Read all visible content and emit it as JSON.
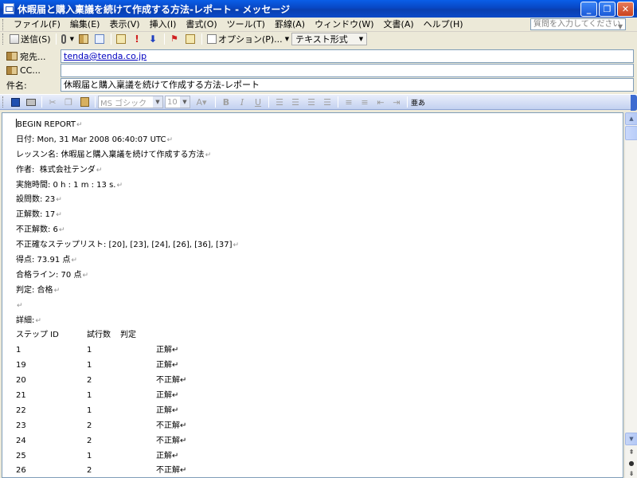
{
  "window": {
    "title": "休暇届と購入稟議を続けて作成する方法-レポート - メッセージ",
    "minimize": "_",
    "maximize": "❐",
    "close": "✕"
  },
  "menu": {
    "items": [
      "ファイル(F)",
      "編集(E)",
      "表示(V)",
      "挿入(I)",
      "書式(O)",
      "ツール(T)",
      "罫線(A)",
      "ウィンドウ(W)",
      "文書(A)",
      "ヘルプ(H)"
    ],
    "help_placeholder": "質問を入力してください"
  },
  "toolbar": {
    "send_label": "送信(S)",
    "options_label": "オプション(P)...",
    "format_value": "テキスト形式"
  },
  "fields": {
    "to_label": "宛先...",
    "to_value": "tenda@tenda.co.jp",
    "cc_label": "CC...",
    "cc_value": "",
    "subject_label": "件名:",
    "subject_value": "休暇届と購入稟議を続けて作成する方法-レポート"
  },
  "format_toolbar": {
    "font_name": "MS ゴシック",
    "font_size": "10",
    "bold": "B",
    "italic": "I",
    "underline": "U"
  },
  "body": {
    "lines": [
      "BEGIN REPORT",
      "日付: Mon, 31 Mar 2008 06:40:07 UTC",
      "レッスン名: 休暇届と購入稟議を続けて作成する方法",
      "作者:  株式会社テンダ",
      "実施時間: 0 h : 1 m : 13 s.",
      "設問数: 23",
      "正解数: 17",
      "不正解数: 6",
      "不正確なステップリスト: [20], [23], [24], [26], [36], [37]",
      "得点: 73.91 点",
      "合格ライン: 70 点",
      "判定: 合格",
      "",
      "詳細:"
    ],
    "table_header": [
      "ステップ ID",
      "試行数",
      "判定"
    ],
    "rows": [
      {
        "id": "1",
        "tries": "1",
        "result": "正解"
      },
      {
        "id": "19",
        "tries": "1",
        "result": "正解"
      },
      {
        "id": "20",
        "tries": "2",
        "result": "不正解"
      },
      {
        "id": "21",
        "tries": "1",
        "result": "正解"
      },
      {
        "id": "22",
        "tries": "1",
        "result": "正解"
      },
      {
        "id": "23",
        "tries": "2",
        "result": "不正解"
      },
      {
        "id": "24",
        "tries": "2",
        "result": "不正解"
      },
      {
        "id": "25",
        "tries": "1",
        "result": "正解"
      },
      {
        "id": "26",
        "tries": "2",
        "result": "不正解"
      }
    ]
  }
}
